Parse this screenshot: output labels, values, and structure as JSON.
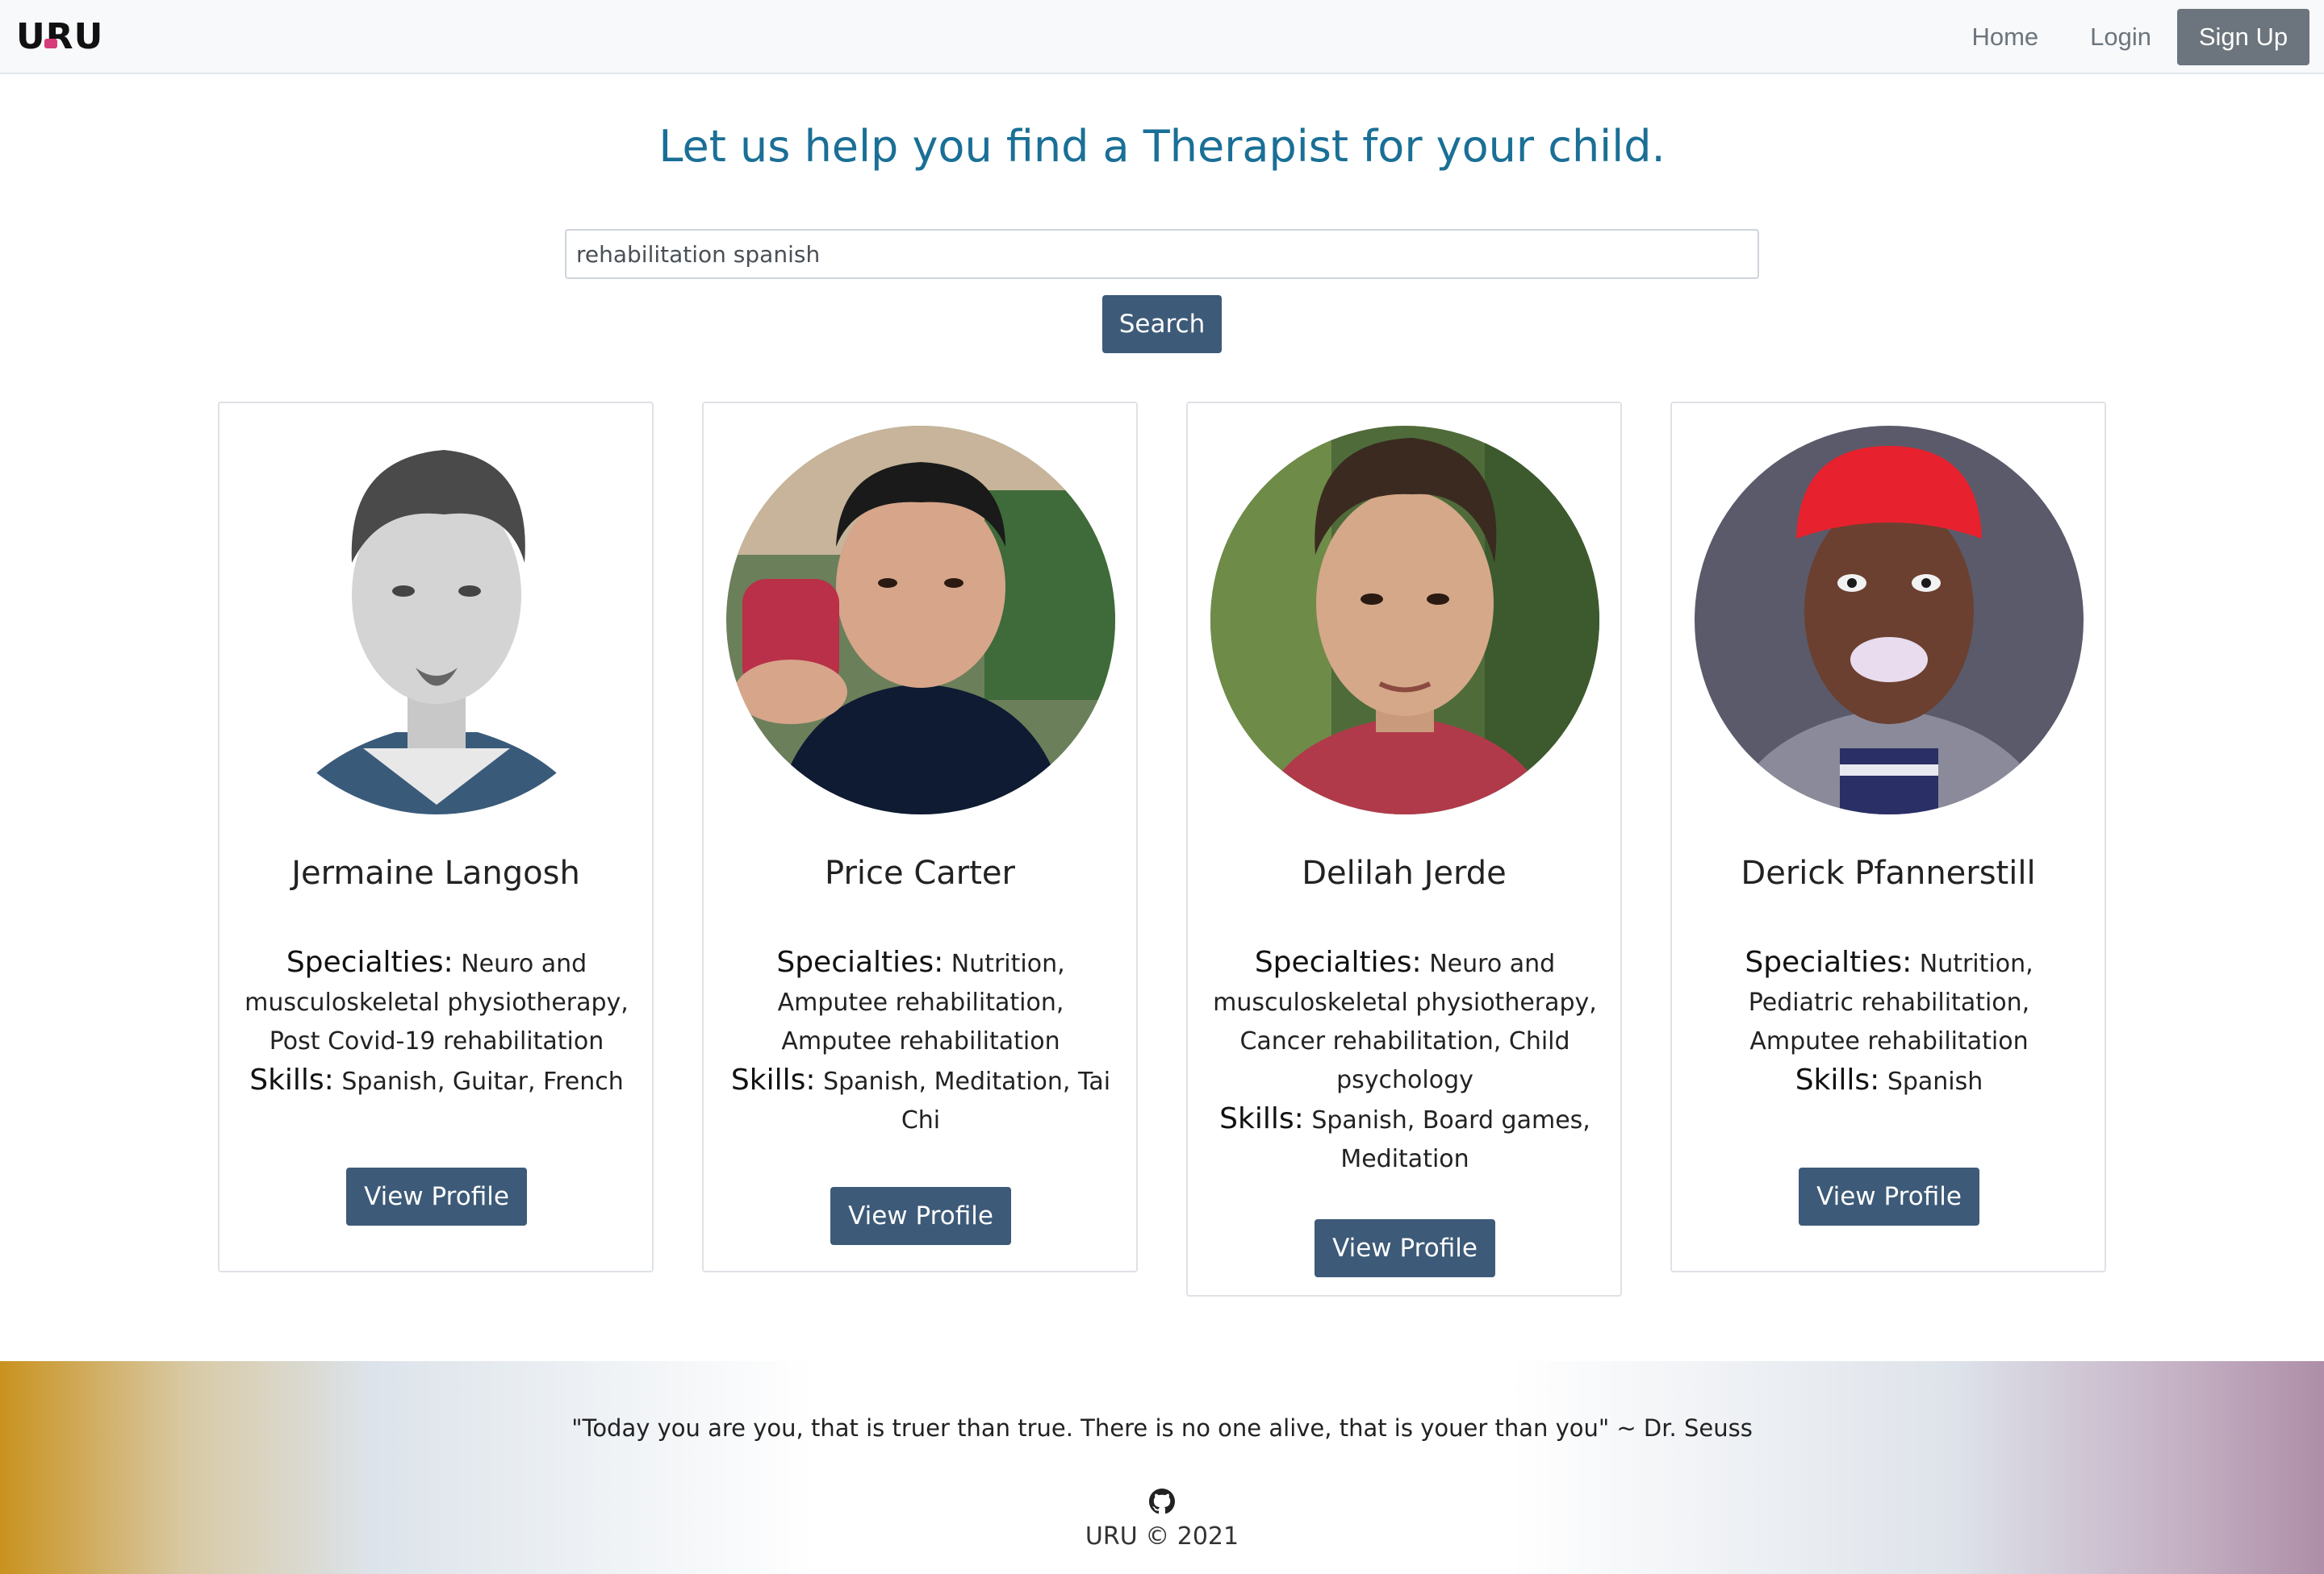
{
  "nav": {
    "brand": "URU",
    "links": [
      "Home",
      "Login"
    ],
    "signup": "Sign Up"
  },
  "hero": {
    "title": "Let us help you find a Therapist for your child."
  },
  "search": {
    "value": "rehabilitation spanish",
    "button": "Search"
  },
  "cards": [
    {
      "name": "Jermaine Langosh",
      "specialties_label": "Specialties:",
      "specialties": "Neuro and musculoskeletal physiotherapy, Post Covid-19 rehabilitation",
      "skills_label": "Skills:",
      "skills": "Spanish, Guitar, French",
      "button": "View Profile"
    },
    {
      "name": "Price Carter",
      "specialties_label": "Specialties:",
      "specialties": "Nutrition, Amputee rehabilitation, Amputee rehabilitation",
      "skills_label": "Skills:",
      "skills": "Spanish, Meditation, Tai Chi",
      "button": "View Profile"
    },
    {
      "name": "Delilah Jerde",
      "specialties_label": "Specialties:",
      "specialties": "Neuro and musculoskeletal physiotherapy, Cancer rehabilitation, Child psychology",
      "skills_label": "Skills:",
      "skills": "Spanish, Board games, Meditation",
      "button": "View Profile"
    },
    {
      "name": "Derick Pfannerstill",
      "specialties_label": "Specialties:",
      "specialties": "Nutrition, Pediatric rehabilitation, Amputee rehabilitation",
      "skills_label": "Skills:",
      "skills": "Spanish",
      "button": "View Profile"
    }
  ],
  "footer": {
    "quote": "\"Today you are you, that is truer than true. There is no one alive, that is youer than you\" ~ Dr. Seuss",
    "icon": "github-icon",
    "copyright": "URU © 2021"
  }
}
